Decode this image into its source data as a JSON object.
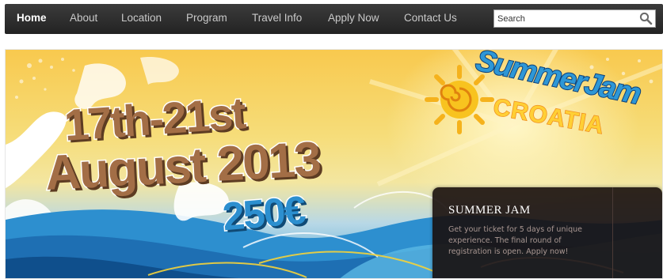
{
  "nav": {
    "items": [
      {
        "label": "Home",
        "active": true
      },
      {
        "label": "About",
        "active": false
      },
      {
        "label": "Location",
        "active": false
      },
      {
        "label": "Program",
        "active": false
      },
      {
        "label": "Travel Info",
        "active": false
      },
      {
        "label": "Apply Now",
        "active": false
      },
      {
        "label": "Contact Us",
        "active": false
      }
    ],
    "search": {
      "placeholder": "Search",
      "icon": "magnifier-icon"
    }
  },
  "banner": {
    "date_line_1": "17th-21st",
    "date_line_2": "August 2013",
    "price": "250€",
    "logo": {
      "summer": "SummerJam",
      "croatia": "CROATIA",
      "icon": "sun-icon"
    },
    "card": {
      "title": "SUMMER JAM",
      "text": "Get your ticket for 5 days of unique experience. The final round of registration is open. Apply now!"
    }
  },
  "colors": {
    "nav_bg": "#2e2e2e",
    "nav_active": "#ffffff",
    "nav_text": "#c9c9c9",
    "card_bg": "#180e0c",
    "card_text": "#a99792"
  }
}
